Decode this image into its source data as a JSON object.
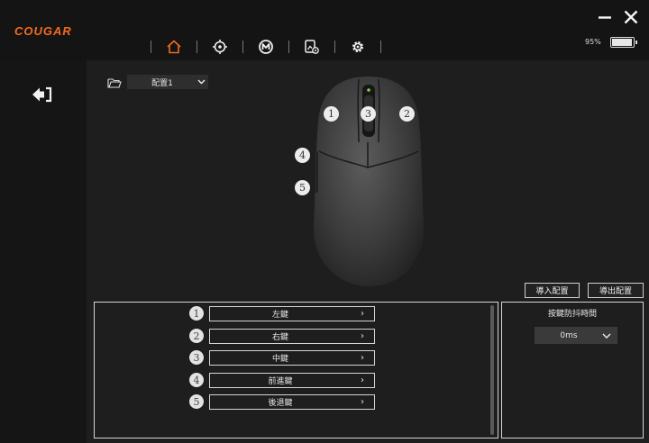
{
  "app": {
    "logo_text": "COUGAR",
    "accent_color": "#f26b1d"
  },
  "nav": {
    "tabs": [
      {
        "icon": "home-icon",
        "active": true
      },
      {
        "icon": "dpi-target-icon",
        "active": false
      },
      {
        "icon": "macro-m-icon",
        "active": false
      },
      {
        "icon": "lighting-settings-icon",
        "active": false
      },
      {
        "icon": "gear-icon",
        "active": false
      }
    ]
  },
  "window": {
    "minimize_icon": "minimize-icon",
    "close_icon": "close-icon"
  },
  "battery": {
    "percent_text": "95%",
    "level": 0.95
  },
  "profile": {
    "selected": "配置1"
  },
  "mouse_badges": [
    "1",
    "2",
    "3",
    "4",
    "5"
  ],
  "actions": {
    "import_label": "導入配置",
    "export_label": "導出配置"
  },
  "buttons": [
    {
      "num": "1",
      "label": "左鍵"
    },
    {
      "num": "2",
      "label": "右鍵"
    },
    {
      "num": "3",
      "label": "中鍵"
    },
    {
      "num": "4",
      "label": "前進鍵"
    },
    {
      "num": "5",
      "label": "後退鍵"
    }
  ],
  "debounce": {
    "title": "按鍵防抖時間",
    "value": "0ms"
  }
}
